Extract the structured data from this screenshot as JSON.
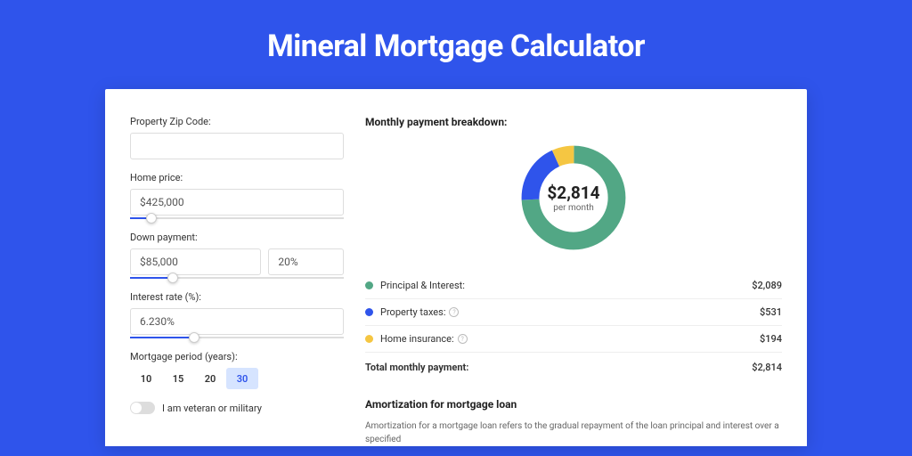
{
  "title": "Mineral Mortgage Calculator",
  "form": {
    "zip_label": "Property Zip Code:",
    "zip_value": "",
    "home_price_label": "Home price:",
    "home_price_value": "$425,000",
    "down_payment_label": "Down payment:",
    "down_payment_value": "$85,000",
    "down_payment_pct": "20%",
    "interest_label": "Interest rate (%):",
    "interest_value": "6.230%",
    "period_label": "Mortgage period (years):",
    "periods": [
      "10",
      "15",
      "20",
      "30"
    ],
    "period_active": "30",
    "veteran_label": "I am veteran or military"
  },
  "breakdown": {
    "title": "Monthly payment breakdown:",
    "center_amount": "$2,814",
    "center_sub": "per month",
    "items": [
      {
        "label": "Principal & Interest:",
        "value": "$2,089",
        "color": "#52a785",
        "info": false
      },
      {
        "label": "Property taxes:",
        "value": "$531",
        "color": "#2f54eb",
        "info": true
      },
      {
        "label": "Home insurance:",
        "value": "$194",
        "color": "#f5c642",
        "info": true
      }
    ],
    "total_label": "Total monthly payment:",
    "total_value": "$2,814"
  },
  "chart_data": {
    "type": "pie",
    "title": "Monthly payment breakdown",
    "series": [
      {
        "name": "Principal & Interest",
        "value": 2089,
        "color": "#52a785"
      },
      {
        "name": "Property taxes",
        "value": 531,
        "color": "#2f54eb"
      },
      {
        "name": "Home insurance",
        "value": 194,
        "color": "#f5c642"
      }
    ],
    "total": 2814
  },
  "amortization": {
    "title": "Amortization for mortgage loan",
    "text": "Amortization for a mortgage loan refers to the gradual repayment of the loan principal and interest over a specified"
  }
}
